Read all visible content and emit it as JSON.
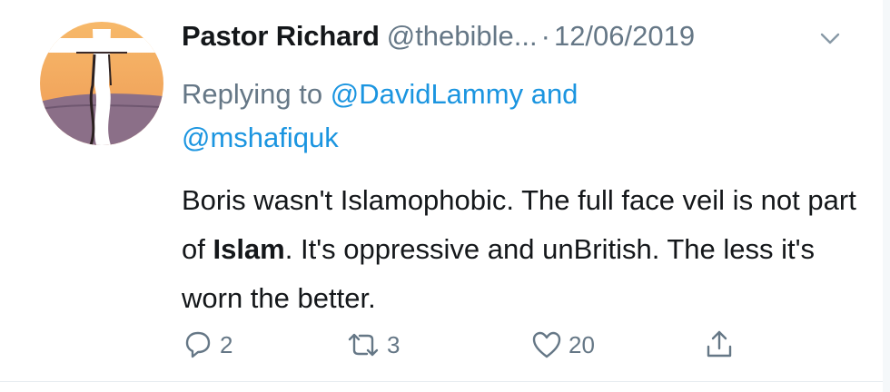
{
  "tweet": {
    "display_name": "Pastor Richard",
    "handle": "@thebible...",
    "separator": "·",
    "date": "12/06/2019",
    "reply_prefix": "Replying to",
    "reply_mention_1": "@DavidLammy",
    "reply_and": "and",
    "reply_mention_2": "@mshafiquk",
    "text_part_1": "Boris wasn't Islamophobic. The full face veil is not part of ",
    "text_bold": "Islam",
    "text_part_2": ". It's oppressive and unBritish. The less it's worn the better."
  },
  "actions": {
    "reply_count": "2",
    "retweet_count": "3",
    "like_count": "20"
  },
  "icons": {
    "avatar": "cross-sunset-avatar",
    "menu": "chevron-down-icon",
    "reply": "reply-bubble-icon",
    "retweet": "retweet-icon",
    "like": "heart-icon",
    "share": "share-icon"
  },
  "colors": {
    "link": "#1b95e0",
    "muted": "#657786",
    "text": "#14171a",
    "avatar_sky": "#f2a25b",
    "avatar_ground": "#8a6f86"
  }
}
